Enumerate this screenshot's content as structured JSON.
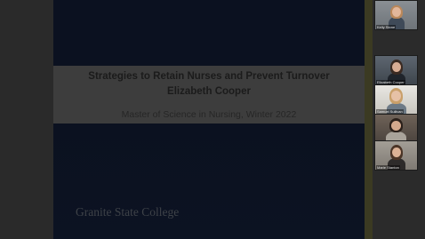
{
  "slide": {
    "title": "Strategies to Retain Nurses and Prevent Turnover",
    "author": "Elizabeth Cooper",
    "subtitle": "Master of Science in Nursing, Winter 2022",
    "footer_logo": "Granite State College"
  },
  "participants": [
    {
      "name": "Kelly Stone"
    },
    {
      "name": "Elizabeth Cooper"
    },
    {
      "name": "Samuel Sullivan"
    },
    {
      "name": ""
    },
    {
      "name": "Marie Stanton"
    }
  ]
}
